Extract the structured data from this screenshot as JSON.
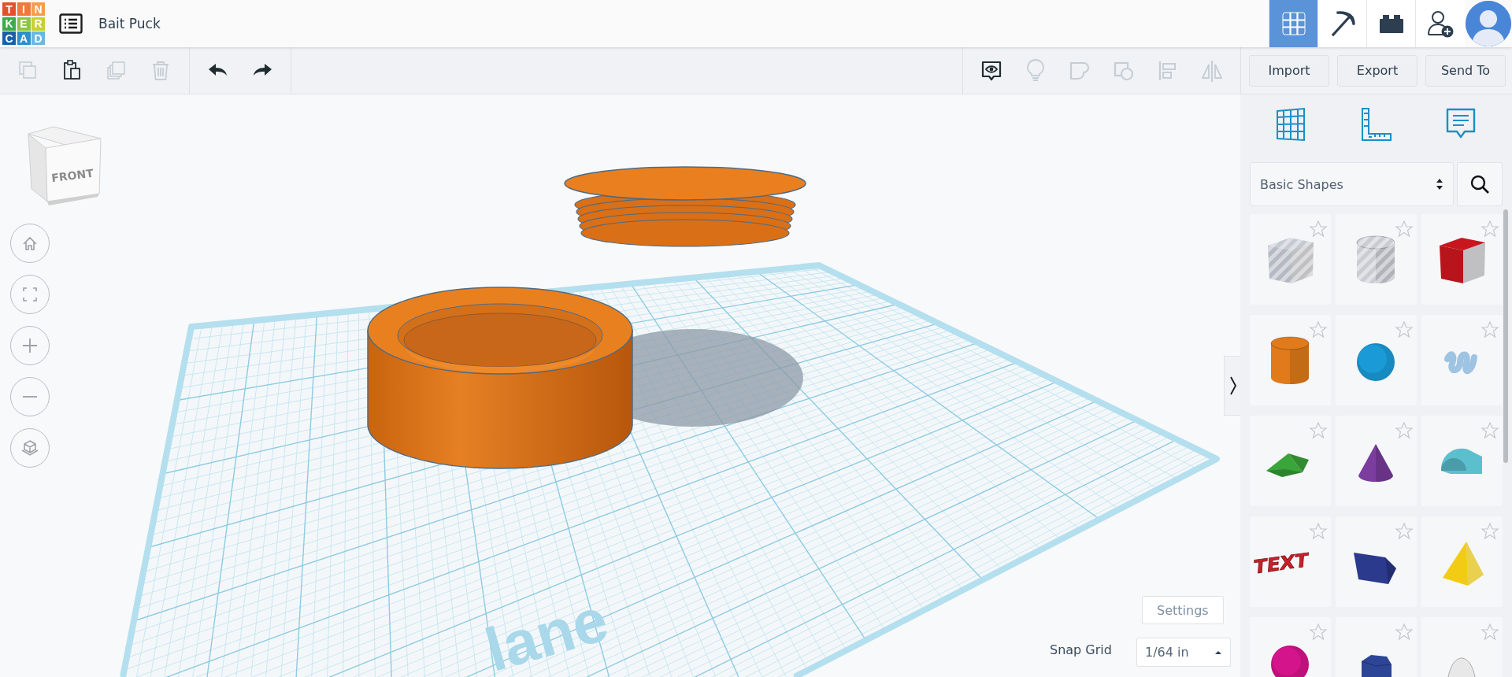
{
  "header": {
    "logo": [
      {
        "text": "T",
        "color": "#e5502a"
      },
      {
        "text": "I",
        "color": "#f0783a"
      },
      {
        "text": "N",
        "color": "#f79c4a"
      },
      {
        "text": "K",
        "color": "#3eaa4b"
      },
      {
        "text": "E",
        "color": "#8dc63f"
      },
      {
        "text": "R",
        "color": "#c8d12f"
      },
      {
        "text": "C",
        "color": "#1a5fa8"
      },
      {
        "text": "A",
        "color": "#2d8fcd"
      },
      {
        "text": "D",
        "color": "#6ab7e0"
      }
    ],
    "title": "Bait Puck",
    "views": [
      {
        "kind": "grid",
        "selected": true
      },
      {
        "kind": "pickaxe",
        "selected": false
      },
      {
        "kind": "bricks",
        "selected": false
      }
    ]
  },
  "toolbar": {
    "edit_tools": [
      {
        "kind": "copy",
        "disabled": true
      },
      {
        "kind": "paste",
        "disabled": false
      },
      {
        "kind": "duplicate",
        "disabled": true
      },
      {
        "kind": "delete",
        "disabled": true
      }
    ],
    "history_tools": [
      {
        "kind": "undo",
        "disabled": false
      },
      {
        "kind": "redo",
        "disabled": false
      }
    ],
    "shape_tools": [
      {
        "kind": "notes",
        "disabled": false
      },
      {
        "kind": "bulb",
        "disabled": true
      },
      {
        "kind": "group",
        "disabled": true
      },
      {
        "kind": "ungroup",
        "disabled": true
      },
      {
        "kind": "align",
        "disabled": true
      },
      {
        "kind": "mirror",
        "disabled": true
      }
    ],
    "buttons": [
      "Import",
      "Export",
      "Send To"
    ]
  },
  "view_cube": {
    "face_label": "FRONT"
  },
  "workplane": {
    "label": "lane"
  },
  "settings_button": "Settings",
  "snap_grid": {
    "label": "Snap Grid",
    "value": "1/64 in"
  },
  "panel": {
    "tabs": [
      {
        "kind": "workplane"
      },
      {
        "kind": "ruler"
      },
      {
        "kind": "notes"
      }
    ],
    "category": "Basic Shapes",
    "shapes": [
      {
        "kind": "box",
        "hole": true,
        "color": "#c4c9d4",
        "favorite": false
      },
      {
        "kind": "cylinder",
        "hole": true,
        "color": "#c9ccd3",
        "favorite": false
      },
      {
        "kind": "box",
        "hole": false,
        "color": "#c8161f",
        "favorite": false
      },
      {
        "kind": "cylinder",
        "hole": false,
        "color": "#e07a1a",
        "favorite": false
      },
      {
        "kind": "sphere",
        "hole": false,
        "color": "#1a9ad6",
        "favorite": false
      },
      {
        "kind": "scribble",
        "hole": false,
        "color": "#9ec3e3",
        "favorite": false
      },
      {
        "kind": "roof",
        "hole": false,
        "color": "#3aa53a",
        "favorite": false
      },
      {
        "kind": "cone",
        "hole": false,
        "color": "#7b3d9e",
        "favorite": false
      },
      {
        "kind": "round-roof",
        "hole": false,
        "color": "#5bbfce",
        "favorite": false
      },
      {
        "kind": "text",
        "hole": false,
        "color": "#c9202a",
        "favorite": false,
        "label": "TEXT"
      },
      {
        "kind": "wedge",
        "hole": false,
        "color": "#2b3a8c",
        "favorite": false
      },
      {
        "kind": "pyramid",
        "hole": false,
        "color": "#f2cc14",
        "favorite": false
      },
      {
        "kind": "sphere",
        "hole": false,
        "color": "#d4148a",
        "favorite": false
      },
      {
        "kind": "polygon",
        "hole": false,
        "color": "#2d4596",
        "favorite": false
      },
      {
        "kind": "paraboloid",
        "hole": false,
        "color": "#e8e8e8",
        "favorite": false
      }
    ]
  }
}
